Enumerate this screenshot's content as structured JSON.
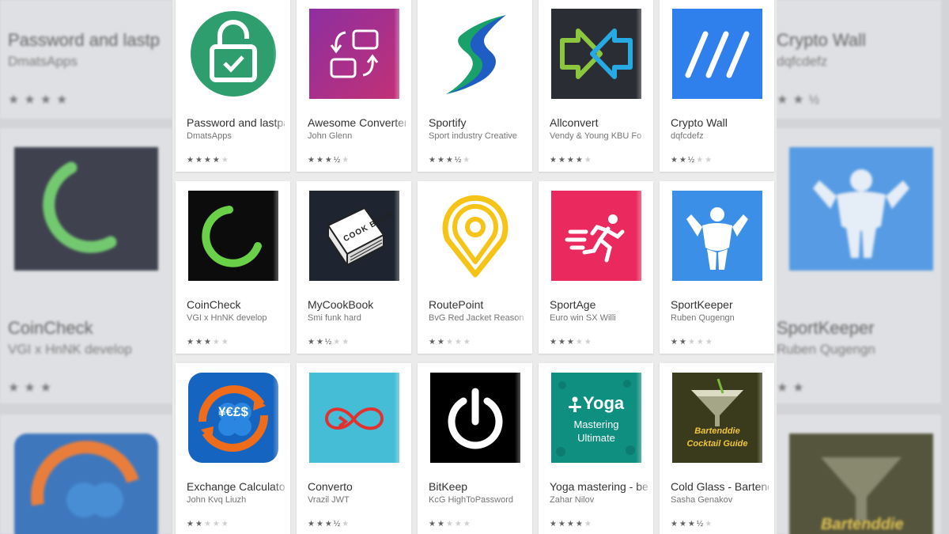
{
  "apps": [
    {
      "name": "Password and lastpass",
      "developer": "DmatsApps",
      "stars": "★★★★",
      "stars_off": "★",
      "rating": 4
    },
    {
      "name": "Awesome Converter",
      "developer": "John Glenn",
      "stars": "★★★½",
      "stars_off": "★",
      "rating": 3.5
    },
    {
      "name": "Sportify",
      "developer": "Sport industry Creative",
      "stars": "★★★½",
      "stars_off": "★",
      "rating": 3.5
    },
    {
      "name": "Allconvert",
      "developer": "Vendy & Young KBU Fo",
      "stars": "★★★★",
      "stars_off": "★",
      "rating": 4
    },
    {
      "name": "Crypto Wall",
      "developer": "dqfcdefz",
      "stars": "★★½",
      "stars_off": "★★",
      "rating": 2.5
    },
    {
      "name": "CoinCheck",
      "developer": "VGI x HnNK develop",
      "stars": "★★★",
      "stars_off": "★★",
      "rating": 3
    },
    {
      "name": "MyCookBook",
      "developer": "Smi funk hard",
      "stars": "★★½",
      "stars_off": "★★",
      "rating": 2.5
    },
    {
      "name": "RoutePoint",
      "developer": "BvG Red Jacket Reason",
      "stars": "★★",
      "stars_off": "★★★",
      "rating": 2
    },
    {
      "name": "SportAge",
      "developer": "Euro win SX Willi",
      "stars": "★★★",
      "stars_off": "★★",
      "rating": 3
    },
    {
      "name": "SportKeeper",
      "developer": "Ruben Qugengn",
      "stars": "★★",
      "stars_off": "★★★",
      "rating": 2
    },
    {
      "name": "Exchange Calculator",
      "developer": "John Kvq Liuzh",
      "stars": "★★",
      "stars_off": "★★★",
      "rating": 2
    },
    {
      "name": "Converto",
      "developer": "Vrazil JWT",
      "stars": "★★★½",
      "stars_off": "★",
      "rating": 3.5
    },
    {
      "name": "BitKeep",
      "developer": "KcG HighToPassword",
      "stars": "★★",
      "stars_off": "★★★",
      "rating": 2
    },
    {
      "name": "Yoga mastering - best",
      "developer": "Zahar Nilov",
      "stars": "★★★★",
      "stars_off": "★",
      "rating": 4
    },
    {
      "name": "Cold Glass - Bartender",
      "developer": "Sasha Genakov",
      "stars": "★★★½",
      "stars_off": "★",
      "rating": 3.5
    }
  ],
  "icon_text": {
    "cookbook": "COOK BOOK",
    "yoga_word": "Yoga",
    "yoga_line1": "Mastering",
    "yoga_line2": "Ultimate",
    "bartender_line1": "Bartenddie",
    "bartender_line2": "Cocktail Guide",
    "exchange_symbols": "¥€£$"
  },
  "backdrop_left": {
    "row1_name": "Password and lastp",
    "row1_dev": "DmatsApps",
    "row1_stars": "★★★★",
    "row2_name": "CoinCheck",
    "row2_dev": "VGI x HnNK develop",
    "row2_stars": "★★★"
  },
  "backdrop_right": {
    "row1_name": "Crypto Wall",
    "row1_dev": "dqfcdefz",
    "row1_stars": "★★½",
    "row2_name": "SportKeeper",
    "row2_dev": "Ruben Qugengn",
    "row2_stars": "★★",
    "row3_name": "Bartenddie"
  },
  "colors": {
    "password_green": "#2f9e6e",
    "converter_purple": "#7b2f8f",
    "allconvert_dark": "#2b2d35",
    "crypto_blue": "#2f80ed",
    "coincheck_green": "#6ad048",
    "sportage_pink": "#ea2a5f",
    "sportkeeper_blue": "#3b8fe6",
    "converto_teal": "#45bdd6",
    "yoga_teal": "#0f8f80",
    "bartender_olive": "#3a3a1c",
    "exchange_blue": "#1565c0",
    "exchange_orange": "#ef6c1a"
  }
}
